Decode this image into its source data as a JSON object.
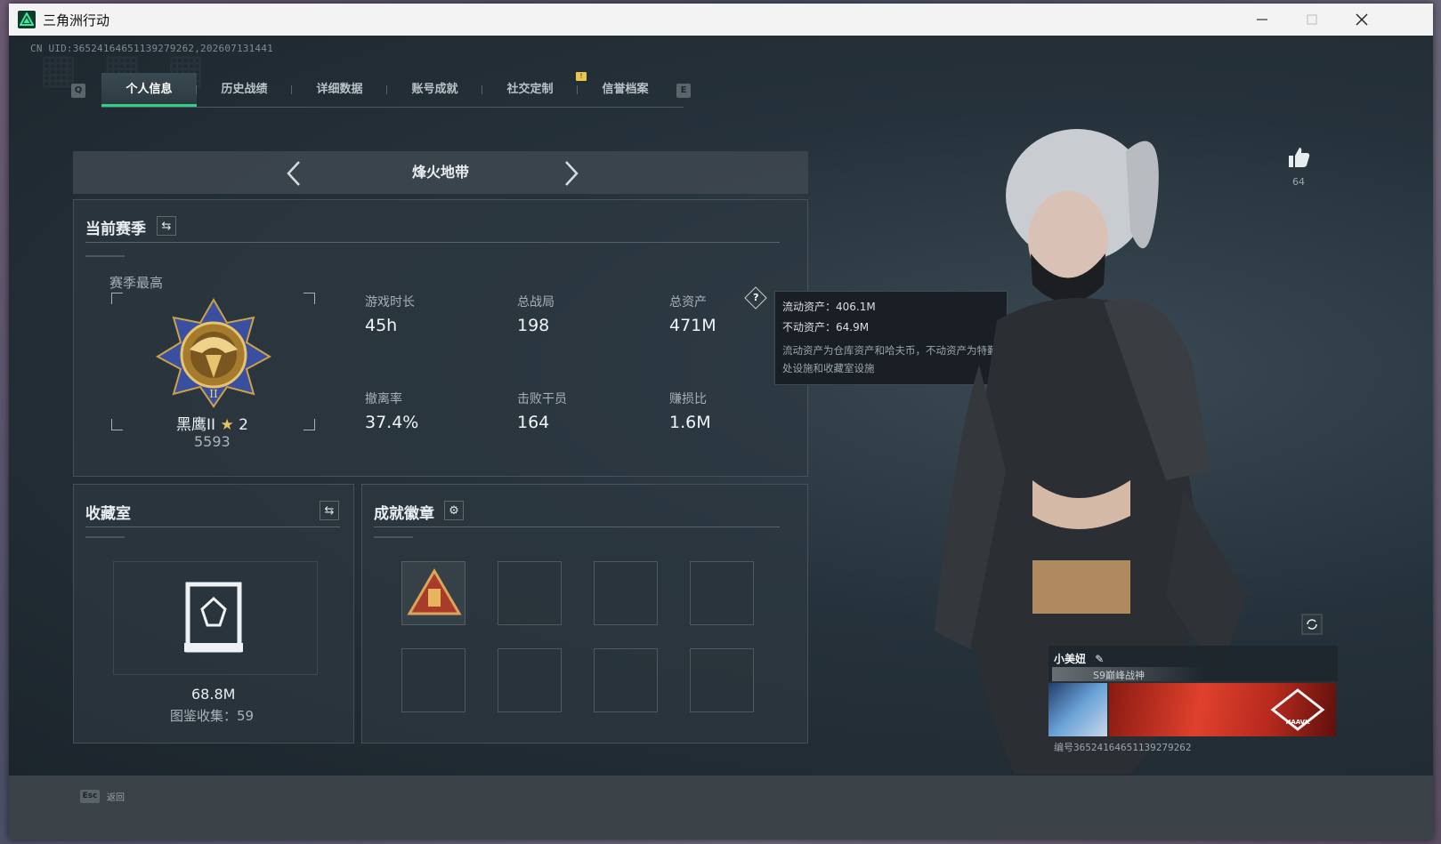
{
  "window": {
    "title": "三角洲行动"
  },
  "header": {
    "uid": "CN UID:3652416465113927926​2,202607131441"
  },
  "tabs": {
    "left_key": "Q",
    "right_key": "E",
    "items": [
      {
        "label": "个人信息",
        "active": true
      },
      {
        "label": "历史战绩"
      },
      {
        "label": "详细数据"
      },
      {
        "label": "账号成就"
      },
      {
        "label": "社交定制"
      },
      {
        "label": "信誉档案"
      }
    ]
  },
  "mode": {
    "title": "烽火地带"
  },
  "season": {
    "title": "当前赛季",
    "best_label": "赛季最高",
    "rank_name": "黑鹰II",
    "rank_stars": "2",
    "rank_score": "5593",
    "stats": [
      {
        "label": "游戏时长",
        "value": "45h"
      },
      {
        "label": "总战局",
        "value": "198"
      },
      {
        "label": "总资产",
        "value": "471M"
      },
      {
        "label": "撤离率",
        "value": "37.4%"
      },
      {
        "label": "击败干员",
        "value": "164"
      },
      {
        "label": "赚损比",
        "value": "1.6M"
      }
    ]
  },
  "tooltip": {
    "line1": "流动资产：406.1M",
    "line2": "不动资产：64.9M",
    "desc": "流动资产为仓库资产和哈夫币，不动资产为特勤处设施和收藏室设施"
  },
  "collection": {
    "title": "收藏室",
    "value": "68.8M",
    "sub": "图鉴收集：59"
  },
  "badges": {
    "title": "成就徽章"
  },
  "profile": {
    "like_count": "64",
    "name": "小美妞",
    "title": "S9巅峰战神",
    "id": "编号3652416465113927926​2"
  },
  "footer": {
    "esc_key": "Esc",
    "back_label": "返回"
  },
  "colors": {
    "accent": "#2ecf84",
    "badge": "#e8c74a"
  }
}
